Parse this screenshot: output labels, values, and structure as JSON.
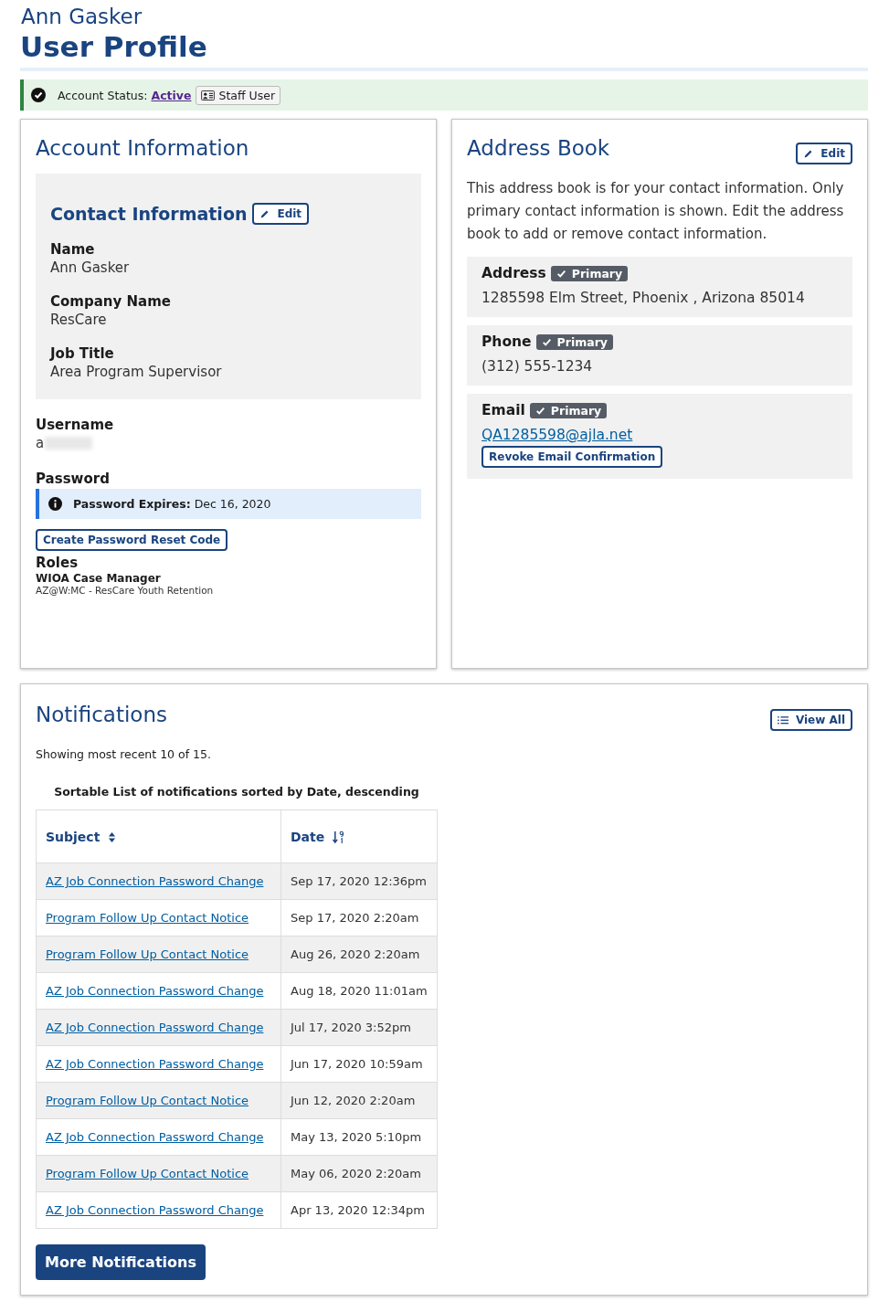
{
  "header": {
    "subtitle": "Ann Gasker",
    "title": "User Profile"
  },
  "status": {
    "label": "Account Status:",
    "value": "Active",
    "badge": "Staff User"
  },
  "account": {
    "title": "Account Information",
    "contact": {
      "title": "Contact Information",
      "edit": "Edit",
      "fields": [
        {
          "label": "Name",
          "value": "Ann Gasker"
        },
        {
          "label": "Company Name",
          "value": "ResCare"
        },
        {
          "label": "Job Title",
          "value": "Area Program Supervisor"
        }
      ]
    },
    "username": {
      "label": "Username",
      "value": "a"
    },
    "password": {
      "label": "Password",
      "expires_label": "Password Expires:",
      "expires_value": "Dec 16, 2020",
      "button": "Create Password Reset Code"
    },
    "roles": {
      "label": "Roles",
      "name": "WIOA Case Manager",
      "detail": "AZ@W:MC - ResCare Youth Retention"
    }
  },
  "address_book": {
    "title": "Address Book",
    "edit": "Edit",
    "intro": "This address book is for your contact information. Only primary contact information is shown. Edit the address book to add or remove contact information.",
    "entries": [
      {
        "kind": "text",
        "label": "Address",
        "badge": "Primary",
        "value": "1285598 Elm Street, Phoenix , Arizona 85014"
      },
      {
        "kind": "text",
        "label": "Phone",
        "badge": "Primary",
        "value": "(312) 555-1234"
      },
      {
        "kind": "email",
        "label": "Email",
        "badge": "Primary",
        "value": "QA1285598@ajla.net",
        "button": "Revoke Email Confirmation"
      }
    ]
  },
  "notifications": {
    "title": "Notifications",
    "view_all": "View All",
    "summary": "Showing most recent 10 of 15.",
    "caption": "Sortable List of notifications sorted by Date, descending",
    "columns": [
      {
        "label": "Subject",
        "sorted": false
      },
      {
        "label": "Date",
        "sorted": true
      }
    ],
    "rows": [
      {
        "subject": "AZ Job Connection Password Change",
        "date": "Sep 17, 2020 12:36pm"
      },
      {
        "subject": "Program Follow Up Contact Notice",
        "date": "Sep 17, 2020 2:20am"
      },
      {
        "subject": "Program Follow Up Contact Notice",
        "date": "Aug 26, 2020 2:20am"
      },
      {
        "subject": "AZ Job Connection Password Change",
        "date": "Aug 18, 2020 11:01am"
      },
      {
        "subject": "AZ Job Connection Password Change",
        "date": "Jul 17, 2020 3:52pm"
      },
      {
        "subject": "AZ Job Connection Password Change",
        "date": "Jun 17, 2020 10:59am"
      },
      {
        "subject": "Program Follow Up Contact Notice",
        "date": "Jun 12, 2020 2:20am"
      },
      {
        "subject": "AZ Job Connection Password Change",
        "date": "May 13, 2020 5:10pm"
      },
      {
        "subject": "Program Follow Up Contact Notice",
        "date": "May 06, 2020 2:20am"
      },
      {
        "subject": "AZ Job Connection Password Change",
        "date": "Apr 13, 2020 12:34pm"
      }
    ],
    "more": "More Notifications"
  }
}
